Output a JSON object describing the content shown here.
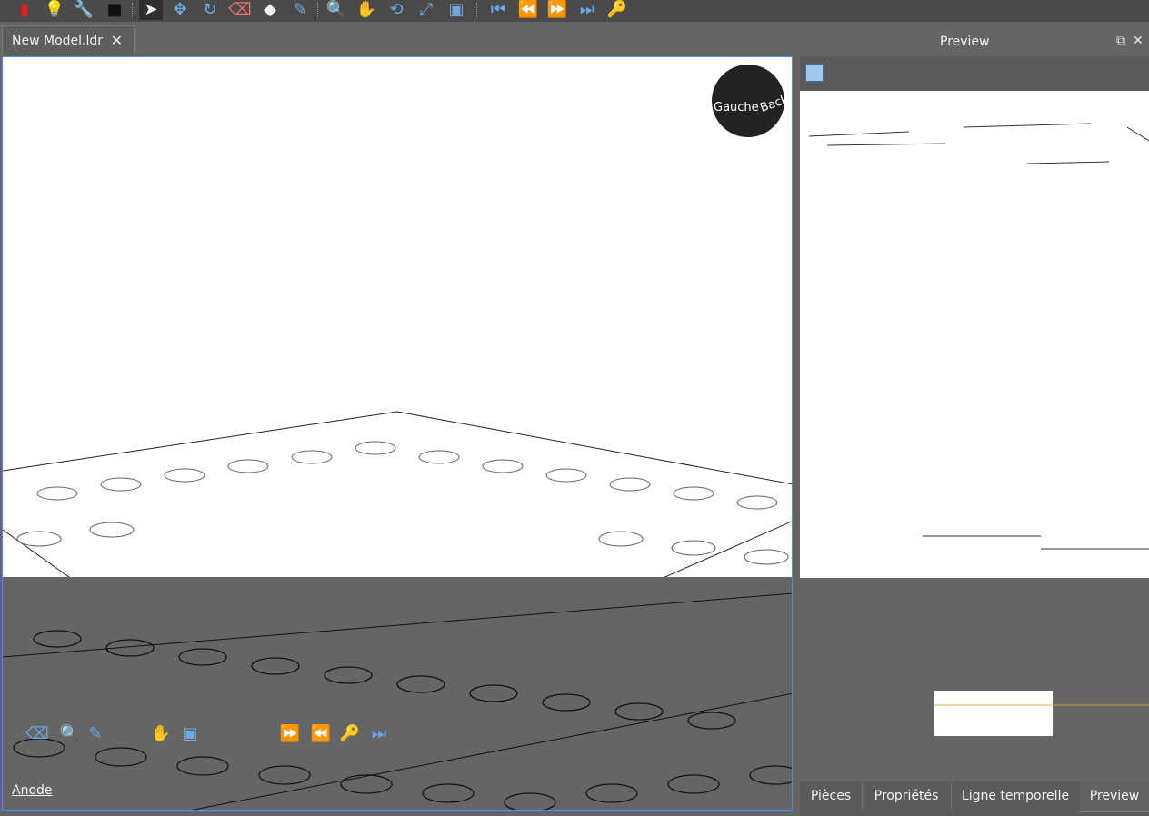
{
  "toolbar": {
    "buttons": [
      {
        "name": "red-brick-icon",
        "glyph": "▮",
        "color": "#e02020"
      },
      {
        "name": "lightbulb-icon",
        "glyph": "💡",
        "color": "#f3c333"
      },
      {
        "name": "wrench-icon",
        "glyph": "🔧",
        "color": "#e6a800"
      },
      {
        "name": "camera-icon",
        "glyph": "■",
        "color": "#111111"
      },
      {
        "name": "select-arrow-icon",
        "glyph": "➤",
        "color": "#f2f2f2"
      },
      {
        "name": "move-icon",
        "glyph": "✥",
        "color": "#4a90e2"
      },
      {
        "name": "rotate-icon",
        "glyph": "↻",
        "color": "#4a90e2"
      },
      {
        "name": "eraser-icon",
        "glyph": "⌫",
        "color": "#f07070"
      },
      {
        "name": "paint-bucket-icon",
        "glyph": "◆",
        "color": "#f2f2f2"
      },
      {
        "name": "eyedropper-icon",
        "glyph": "✎",
        "color": "#4a90e2"
      },
      {
        "name": "zoom-icon",
        "glyph": "🔍",
        "color": "#9ec7ee"
      },
      {
        "name": "pan-hand-icon",
        "glyph": "✋",
        "color": "#f3c333"
      },
      {
        "name": "orbit-icon",
        "glyph": "⟲",
        "color": "#4a90e2"
      },
      {
        "name": "zoom-extents-icon",
        "glyph": "⤢",
        "color": "#4a90e2"
      },
      {
        "name": "zoom-window-icon",
        "glyph": "▣",
        "color": "#9ec7ee"
      },
      {
        "name": "first-step-icon",
        "glyph": "⏮",
        "color": "#4a90e2"
      },
      {
        "name": "previous-step-icon",
        "glyph": "⏪",
        "color": "#4a90e2"
      },
      {
        "name": "next-step-icon",
        "glyph": "⏩",
        "color": "#4a90e2"
      },
      {
        "name": "last-step-icon",
        "glyph": "⏭",
        "color": "#4a90e2"
      },
      {
        "name": "key-icon",
        "glyph": "🔑",
        "color": "#f3c333"
      }
    ]
  },
  "document_tab": {
    "label": "New Model.ldr",
    "close": "✕"
  },
  "viewcube": {
    "front": "Gauche",
    "back": "Back"
  },
  "preview_panel": {
    "title": "Preview"
  },
  "dock_tabs": [
    {
      "label": "Pièces"
    },
    {
      "label": "Propriétés"
    },
    {
      "label": "Ligne temporelle"
    },
    {
      "label": "Preview"
    }
  ],
  "statusbar": {
    "text": "Anode"
  }
}
